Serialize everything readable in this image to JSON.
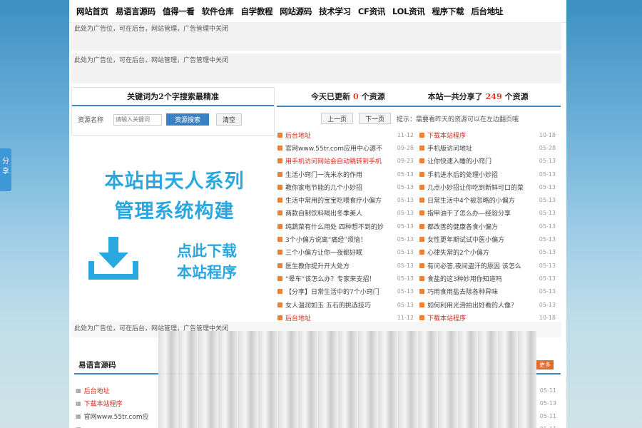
{
  "nav": [
    "网站首页",
    "易语言源码",
    "值得一看",
    "软件仓库",
    "自学教程",
    "网站源码",
    "技术学习",
    "CF资讯",
    "LOL资讯",
    "程序下载",
    "后台地址"
  ],
  "ads": {
    "top1": "此处为广告位，可在后台，网站管理，广告管理中关闭",
    "top2": "此处为广告位，可在后台，网站管理，广告管理中关闭",
    "bottom": "此处为广告位，可在后台，网站管理，广告管理中关闭"
  },
  "search": {
    "title": "关键词为2个字搜索最精准",
    "label": "资源名称",
    "placeholder": "请输入关键词",
    "search_button": "资源搜索",
    "clear_button": "清空"
  },
  "promo": {
    "line1": "本站由天人系列",
    "line2": "管理系统构建",
    "download1": "点此下载",
    "download2": "本站程序"
  },
  "stats": {
    "today_prefix": "今天已更新",
    "today_count": "0",
    "today_suffix": "个资源",
    "total_prefix": "本站一共分享了",
    "total_count": "249",
    "total_suffix": "个资源"
  },
  "pager": {
    "prev": "上一页",
    "next": "下一页",
    "tip": "提示：需要看昨天的资源可以在左边翻页哦"
  },
  "list_left": [
    {
      "title": "后台地址",
      "date": "11-12",
      "hot": true
    },
    {
      "title": "官网www.55tr.com应用中心源不",
      "date": "09-28",
      "hot": false
    },
    {
      "title": "用手机访问网站会自动跳转到手机",
      "date": "09-23",
      "hot": true
    },
    {
      "title": "生活小窍门一洗米水的作用",
      "date": "05-13",
      "hot": false
    },
    {
      "title": "教你家电节能的几个小妙招",
      "date": "05-13",
      "hot": false
    },
    {
      "title": "生活中常用的宝宝吃喂食疗小偏方",
      "date": "05-13",
      "hot": false
    },
    {
      "title": "两款自制饮料喝出冬季美人",
      "date": "05-13",
      "hot": false
    },
    {
      "title": "纯蔬菜有什么用处 四种想不到的妙",
      "date": "05-13",
      "hot": false
    },
    {
      "title": "3个小偏方说离“痛经”烦恼！",
      "date": "05-13",
      "hot": false
    },
    {
      "title": "三个小偏方让你一夜都好眠",
      "date": "05-13",
      "hot": false
    },
    {
      "title": "医生教你提升开大处方",
      "date": "05-13",
      "hot": false
    },
    {
      "title": "“晕车”该怎么办？专家来支招！",
      "date": "05-13",
      "hot": false
    },
    {
      "title": "【分享】日常生活中的7个小窍门",
      "date": "05-13",
      "hot": false
    },
    {
      "title": "女人温润如玉 五石的挑选技巧",
      "date": "05-13",
      "hot": false
    },
    {
      "title": "后台地址",
      "date": "11-12",
      "hot": true
    }
  ],
  "list_right": [
    {
      "title": "下载本站程序",
      "date": "10-18",
      "hot": true
    },
    {
      "title": "手机版访问地址",
      "date": "05-28",
      "hot": false
    },
    {
      "title": "让你快速入睡的小窍门",
      "date": "05-13",
      "hot": false
    },
    {
      "title": "手机进水后的处理小妙招",
      "date": "05-13",
      "hot": false
    },
    {
      "title": "几点小妙招让你吃到新鲜可口的菜",
      "date": "05-13",
      "hot": false
    },
    {
      "title": "日常生活中4个被忽略的小偏方",
      "date": "05-13",
      "hot": false
    },
    {
      "title": "指甲油干了怎么办—经验分享",
      "date": "05-13",
      "hot": false
    },
    {
      "title": "都改善的健康各食小偏方",
      "date": "05-13",
      "hot": false
    },
    {
      "title": "女性更年期试试中医小偏方",
      "date": "05-13",
      "hot": false
    },
    {
      "title": "心律失常的2个小偏方",
      "date": "05-13",
      "hot": false
    },
    {
      "title": "有问必答,夜间盗汗的原因 该怎么",
      "date": "05-13",
      "hot": false
    },
    {
      "title": "食盐的这3种妙用你知道吗",
      "date": "05-13",
      "hot": false
    },
    {
      "title": "巧用食用盐去除各种异味",
      "date": "05-13",
      "hot": false
    },
    {
      "title": "如何利用光滑拍出好看的人像？",
      "date": "05-13",
      "hot": false
    },
    {
      "title": "下载本站程序",
      "date": "10-18",
      "hot": true
    }
  ],
  "bottom": {
    "section_title": "易语言源码",
    "more": "更多",
    "items": [
      {
        "title": "后台地址",
        "date": "05-11",
        "hot": true
      },
      {
        "title": "下载本站程序",
        "date": "05-13",
        "hot": true
      },
      {
        "title": "官网www.55tr.com应",
        "date": "05-11",
        "hot": false
      },
      {
        "title": "",
        "date": "05-11",
        "hot": false
      }
    ]
  },
  "share": "分享",
  "colors": {
    "accent": "#3c8ac9",
    "hot": "#d9261c",
    "promo": "#29a7e1",
    "bullet": "#ef7f32"
  }
}
